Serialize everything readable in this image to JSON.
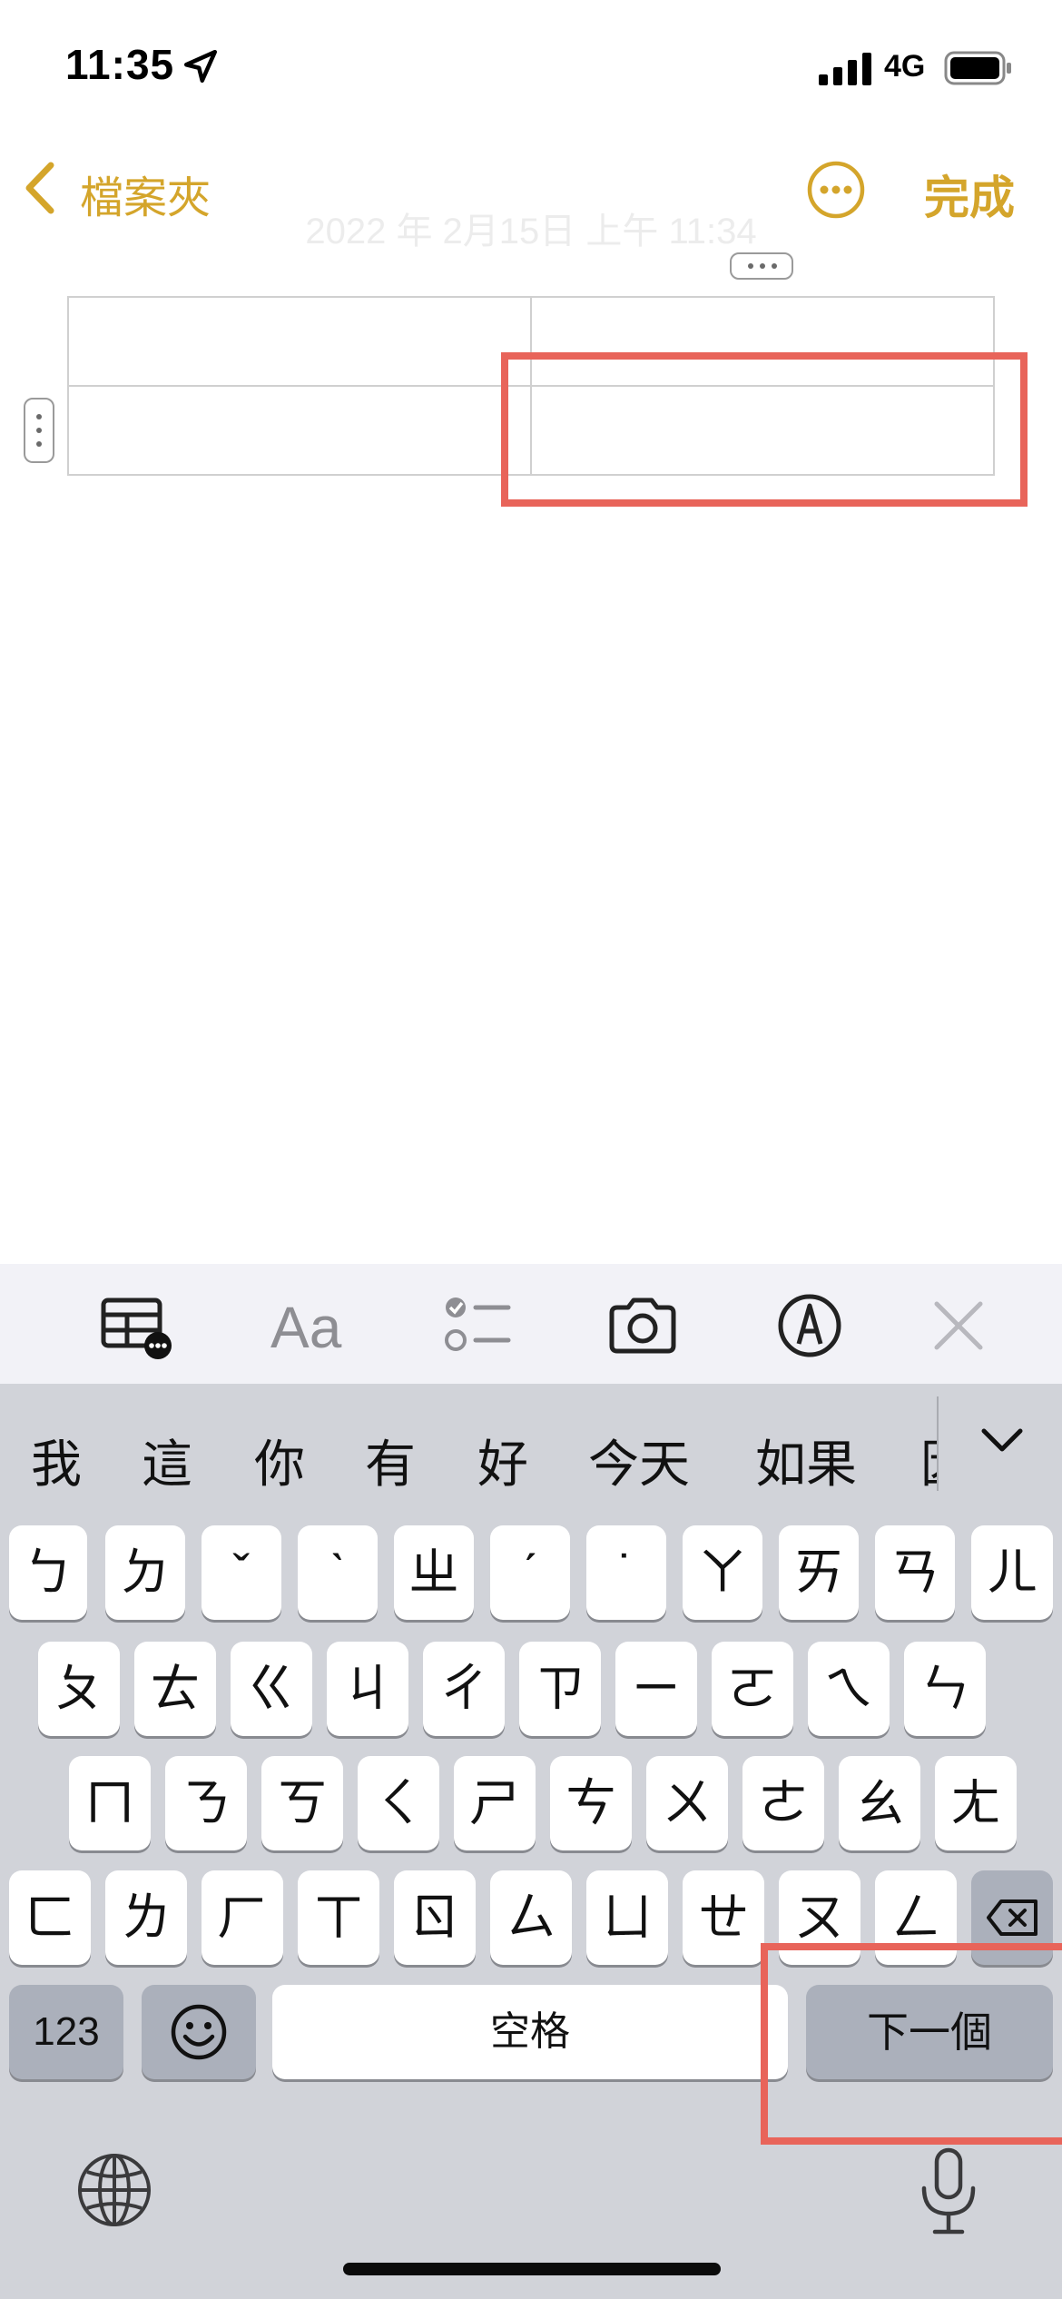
{
  "status_bar": {
    "time": "11:35",
    "network": "4G"
  },
  "nav": {
    "back_label": "檔案夾",
    "done_label": "完成"
  },
  "note": {
    "date": "2022 年 2月15日 上午 11:34"
  },
  "toolbar": {
    "items": [
      "table-icon",
      "text-format-icon",
      "checklist-icon",
      "camera-icon",
      "markup-icon",
      "close-icon"
    ],
    "text_format_label": "Aa"
  },
  "candidates": [
    "我",
    "這",
    "你",
    "有",
    "好",
    "今天",
    "如果",
    "因"
  ],
  "keyboard": {
    "row1": [
      "ㄅ",
      "ㄉ",
      "ˇ",
      "ˋ",
      "ㄓ",
      "ˊ",
      "˙",
      "ㄚ",
      "ㄞ",
      "ㄢ",
      "ㄦ"
    ],
    "row2": [
      "ㄆ",
      "ㄊ",
      "ㄍ",
      "ㄐ",
      "ㄔ",
      "ㄗ",
      "ㄧ",
      "ㄛ",
      "ㄟ",
      "ㄣ"
    ],
    "row3": [
      "ㄇ",
      "ㄋ",
      "ㄎ",
      "ㄑ",
      "ㄕ",
      "ㄘ",
      "ㄨ",
      "ㄜ",
      "ㄠ",
      "ㄤ"
    ],
    "row4": [
      "ㄈ",
      "ㄌ",
      "ㄏ",
      "ㄒ",
      "ㄖ",
      "ㄙ",
      "ㄩ",
      "ㄝ",
      "ㄡ",
      "ㄥ"
    ],
    "numbers_label": "123",
    "space_label": "空格",
    "next_label": "下一個"
  },
  "colors": {
    "accent": "#d4a52b",
    "highlight": "#e8645a",
    "keyboard_bg": "#d1d3d9",
    "dark_key": "#abb0bb"
  }
}
